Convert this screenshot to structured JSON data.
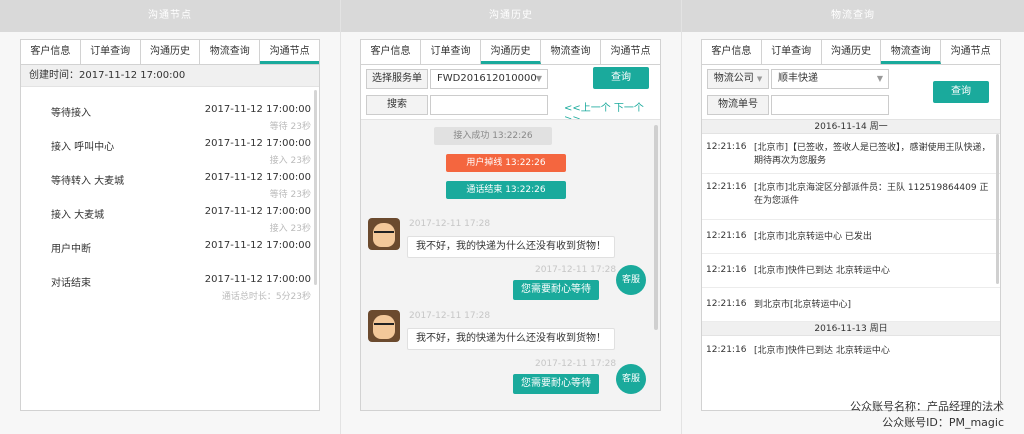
{
  "columns": {
    "col1": {
      "header": "沟通节点"
    },
    "col2": {
      "header": "沟通历史"
    },
    "col3": {
      "header": "物流查询"
    }
  },
  "tabs": [
    "客户信息",
    "订单查询",
    "沟通历史",
    "物流查询",
    "沟通节点"
  ],
  "col1": {
    "created": "创建时间：2017-11-12 17:00:00",
    "nodes": [
      {
        "name": "等待接入",
        "time": "2017-11-12 17:00:00",
        "sub": "等待 23秒"
      },
      {
        "name": "接入 呼叫中心",
        "time": "2017-11-12 17:00:00",
        "sub": "接入 23秒"
      },
      {
        "name": "等待转入 大麦城",
        "time": "2017-11-12 17:00:00",
        "sub": "等待 23秒"
      },
      {
        "name": "接入 大麦城",
        "time": "2017-11-12 17:00:00",
        "sub": "接入 23秒"
      },
      {
        "name": "用户中断",
        "time": "2017-11-12 17:00:00",
        "sub": ""
      },
      {
        "name": "对话结束",
        "time": "2017-11-12 17:00:00",
        "sub": "通话总时长：5分23秒"
      }
    ]
  },
  "col2": {
    "select_label": "选择服务单",
    "select_value": "FWD201612010000",
    "query_btn": "查询",
    "search_label": "搜索",
    "pager": "<<上一个  下一个>>",
    "sys_msgs": [
      "接入成功 13:22:26",
      "用户掉线 13:22:26",
      "通话结束 13:22:26"
    ],
    "chat": [
      {
        "time": "2017-12-11 17:28",
        "text": "我不好，我的快递为什么还没有收到货物！"
      },
      {
        "time": "2017-12-11 17:28",
        "text": "您需要耐心等待"
      },
      {
        "time": "2017-12-11 17:28",
        "text": "我不好，我的快递为什么还没有收到货物！"
      },
      {
        "time": "2017-12-11 17:28",
        "text": "您需要耐心等待"
      }
    ],
    "agent_label": "客服"
  },
  "col3": {
    "company_label": "物流公司",
    "company_value": "顺丰快递",
    "tracking_label": "物流单号",
    "query_btn": "查询",
    "days": [
      {
        "date": "2016-11-14  周一",
        "logs": [
          {
            "time": "12:21:16",
            "text": "[北京市]【已签收，签收人是已签收】，感谢使用王队快递，期待再次为您服务"
          },
          {
            "time": "12:21:16",
            "text": "[北京市]北京海淀区分部派件员：王队 112519864409 正在为您派件"
          },
          {
            "time": "12:21:16",
            "text": "[北京市]北京转运中心 已发出"
          },
          {
            "time": "12:21:16",
            "text": "[北京市]快件已到达 北京转运中心"
          },
          {
            "time": "12:21:16",
            "text": "到北京市[北京转运中心]"
          }
        ]
      },
      {
        "date": "2016-11-13   周日",
        "logs": [
          {
            "time": "12:21:16",
            "text": "[北京市]快件已到达 北京转运中心"
          }
        ]
      }
    ]
  },
  "watermark": {
    "line1": "公众账号名称：产品经理的法术",
    "line2": "公众账号ID：PM_magic"
  },
  "colors": {
    "accent": "#1aaa9c",
    "warning": "#f4663f"
  }
}
